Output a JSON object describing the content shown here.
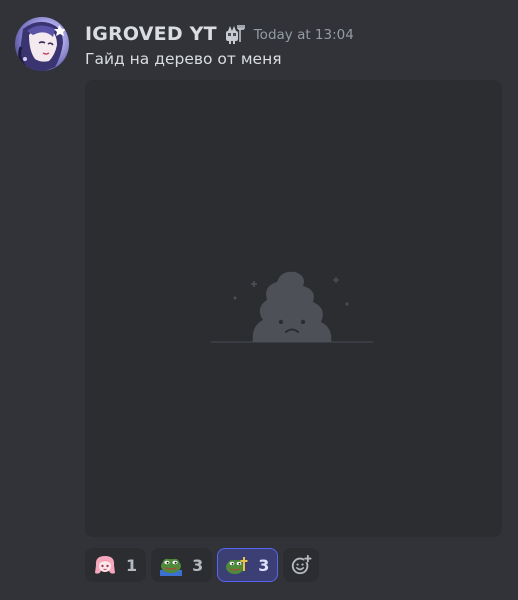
{
  "message": {
    "author": "IGROVED YT",
    "timestamp": "Today at 13:04",
    "text": "Гайд на дерево от меня",
    "badge_icon": "robot-farmer-badge-icon",
    "avatar_icon": "anime-avatar"
  },
  "embed": {
    "state": "failed-to-load",
    "placeholder_icon": "sad-poop-icon"
  },
  "reactions": [
    {
      "emoji": "pink-anime-girl-emoji",
      "count": "1",
      "active": false
    },
    {
      "emoji": "pepe-frog-emoji",
      "count": "3",
      "active": false
    },
    {
      "emoji": "pepe-cross-emoji",
      "count": "3",
      "active": true
    }
  ],
  "add_reaction_icon": "add-reaction-icon",
  "colors": {
    "background": "#313338",
    "embed_background": "#2b2d31",
    "text": "#dbdee1",
    "muted": "#949ba4",
    "active_reaction_border": "#5865f2",
    "active_reaction_bg": "#3b3f74"
  }
}
